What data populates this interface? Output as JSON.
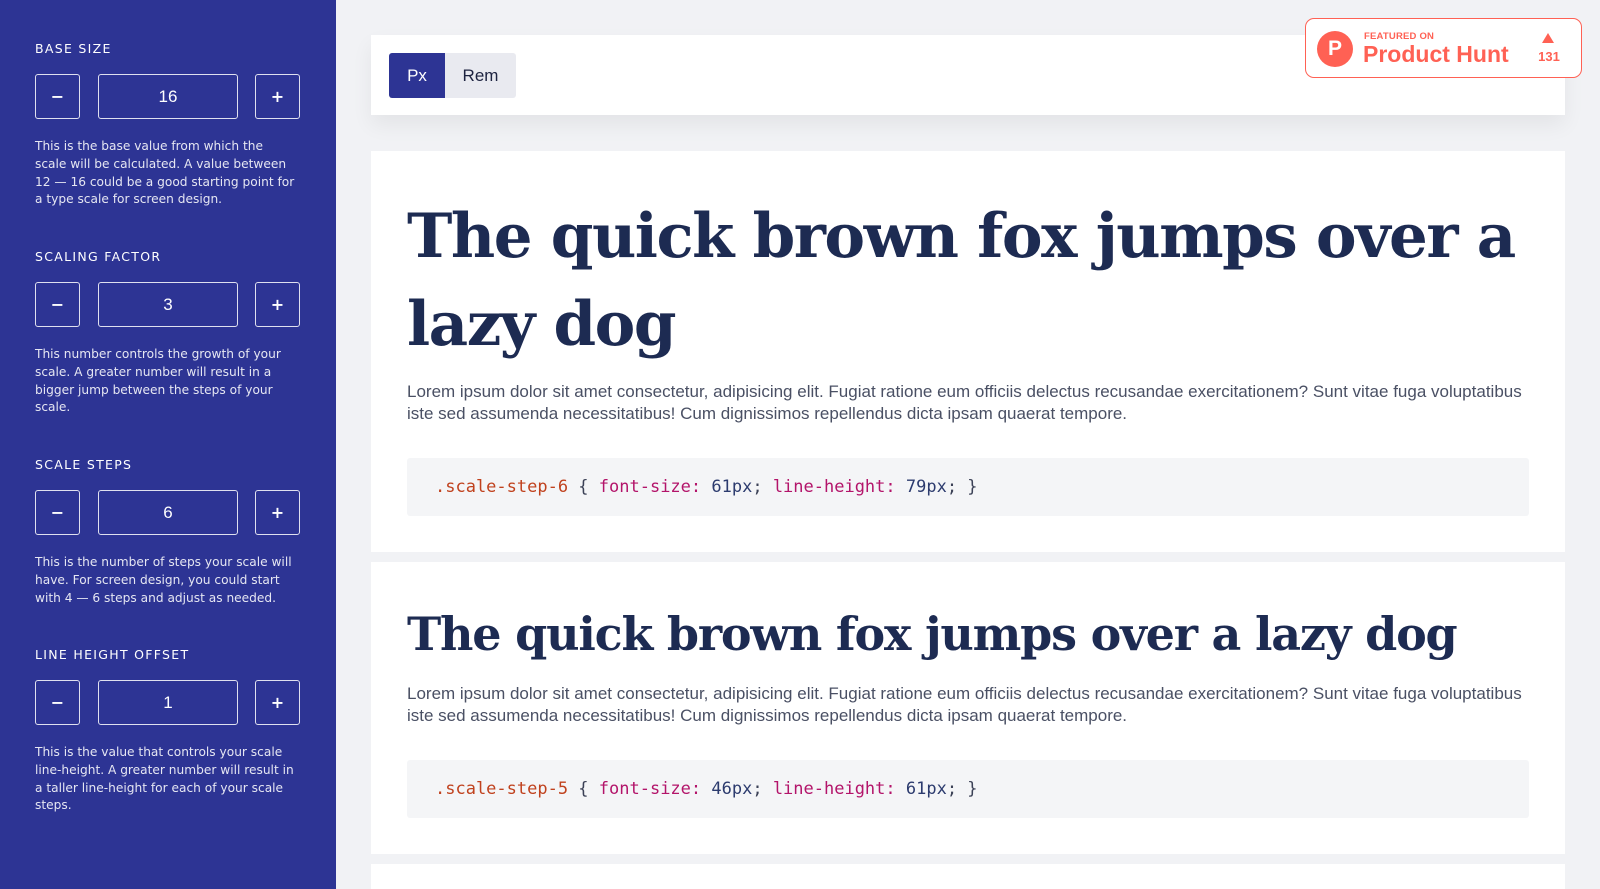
{
  "sidebar": {
    "controls": [
      {
        "title": "Base Size",
        "value": "16",
        "minus": "−",
        "plus": "+",
        "description": "This is the base value from which the scale will be calculated. A value between 12 — 16 could be a good starting point for a type scale for screen design."
      },
      {
        "title": "Scaling Factor",
        "value": "3",
        "minus": "−",
        "plus": "+",
        "description": "This number controls the growth of your scale. A greater number will result in a bigger jump between the steps of your scale."
      },
      {
        "title": "Scale Steps",
        "value": "6",
        "minus": "−",
        "plus": "+",
        "description": "This is the number of steps your scale will have. For screen design, you could start with 4 — 6 steps and adjust as needed."
      },
      {
        "title": "Line Height Offset",
        "value": "1",
        "minus": "−",
        "plus": "+",
        "description": "This is the value that controls your scale line-height. A greater number will result in a taller line-height for each of your scale steps."
      }
    ]
  },
  "toolbar": {
    "unit_px": "Px",
    "unit_rem": "Rem"
  },
  "product_hunt": {
    "featured": "FEATURED ON",
    "name": "Product Hunt",
    "votes": "131",
    "logo_letter": "P"
  },
  "samples": [
    {
      "text": "The quick brown fox jumps over a lazy dog",
      "lorem": "Lorem ipsum dolor sit amet consectetur, adipisicing elit. Fugiat ratione eum officiis delectus recusandae exercitationem? Sunt vitae fuga voluptatibus iste sed assumenda necessitatibus! Cum dignissimos repellendus dicta ipsam quaerat tempore.",
      "code": {
        "selector": ".scale-step-6",
        "open": " { ",
        "prop1": "font-size:",
        "val1": " 61px",
        "sep1": "; ",
        "prop2": "line-height:",
        "val2": " 79px",
        "close": "; }"
      }
    },
    {
      "text": "The quick brown fox jumps over a lazy dog",
      "lorem": "Lorem ipsum dolor sit amet consectetur, adipisicing elit. Fugiat ratione eum officiis delectus recusandae exercitationem? Sunt vitae fuga voluptatibus iste sed assumenda necessitatibus! Cum dignissimos repellendus dicta ipsam quaerat tempore.",
      "code": {
        "selector": ".scale-step-5",
        "open": " { ",
        "prop1": "font-size:",
        "val1": " 46px",
        "sep1": "; ",
        "prop2": "line-height:",
        "val2": " 61px",
        "close": "; }"
      }
    }
  ],
  "colors": {
    "sidebar_bg": "#2d3494",
    "accent": "#2d3494",
    "product_hunt": "#ff6154",
    "heading": "#1d2b52"
  }
}
